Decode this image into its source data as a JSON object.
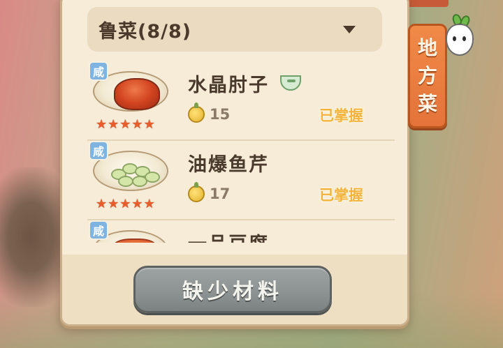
{
  "category_dropdown": {
    "label": "鲁菜(8/8)"
  },
  "side_tab": {
    "chars": [
      "地",
      "方",
      "菜"
    ]
  },
  "dishes": [
    {
      "name": "水晶肘子",
      "taste": "咸",
      "stars": 5,
      "cost": "15",
      "status": "已掌握",
      "icon": "bowl-icon"
    },
    {
      "name": "油爆鱼芹",
      "taste": "咸",
      "stars": 5,
      "cost": "17",
      "status": "已掌握"
    },
    {
      "name": "一品豆腐",
      "taste": "咸"
    }
  ],
  "action_button": {
    "label": "缺少材料"
  },
  "colors": {
    "panel": "#f7ecd8",
    "accent_orange": "#e4733a",
    "status_gold": "#f4b33a",
    "taste_blue": "#7fb4e0",
    "button_gray": "#8c9291"
  }
}
